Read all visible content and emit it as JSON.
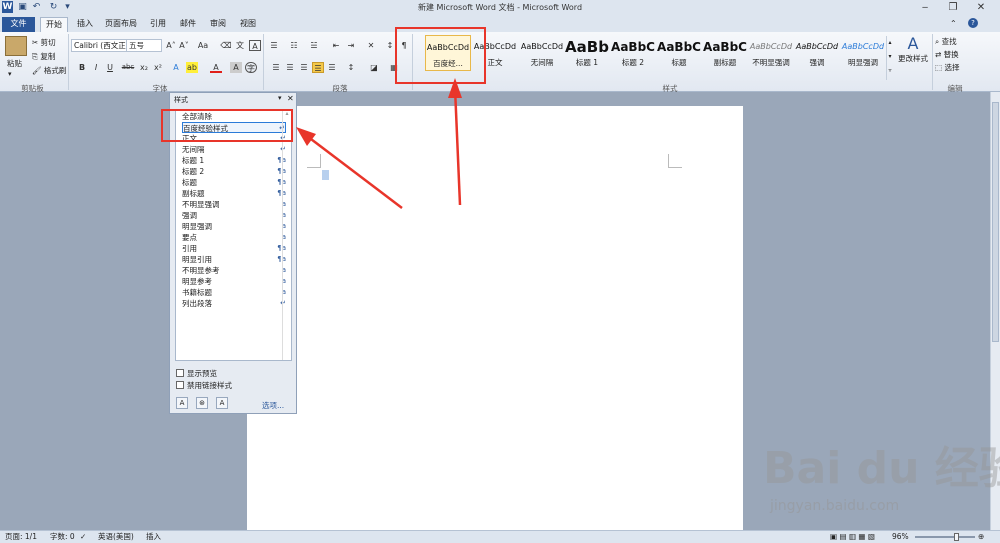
{
  "window": {
    "title": "新建 Microsoft Word 文档 - Microsoft Word",
    "minimize": "‒",
    "restore": "❐",
    "close": "✕"
  },
  "quick_access": {
    "app_icon": "W",
    "save": "▣",
    "undo": "↶",
    "redo": "↻",
    "customize": "▾"
  },
  "tabs": [
    "文件",
    "开始",
    "插入",
    "页面布局",
    "引用",
    "邮件",
    "审阅",
    "视图"
  ],
  "clipboard": {
    "paste": "粘贴",
    "cut": "剪切",
    "copy": "复制",
    "format_painter": "格式刷",
    "group": "剪贴板"
  },
  "font": {
    "name": "Calibri (西文正",
    "size": "五号",
    "grow": "A˄",
    "shrink": "A˅",
    "change_case": "Aa",
    "clear": "⌫",
    "phonetic": "文",
    "border": "A",
    "bold": "B",
    "italic": "I",
    "underline": "U",
    "strike": "abc",
    "sub": "x₂",
    "sup": "x²",
    "effects": "A",
    "highlight": "ab",
    "color": "A",
    "shade": "A",
    "enclose": "字",
    "group": "字体"
  },
  "paragraph": {
    "group": "段落",
    "bullets": "☰",
    "numbering": "☷",
    "multilevel": "☱",
    "dec_indent": "⇤",
    "inc_indent": "⇥",
    "chinese_layout": "✕",
    "sort": "↕",
    "show_marks": "¶",
    "align_left": "☰",
    "center": "☰",
    "align_right": "☰",
    "justify": "☰",
    "distribute": "☰",
    "line_spacing": "↕",
    "shading": "◪",
    "borders": "▦"
  },
  "styles": {
    "group": "样式",
    "items": [
      {
        "preview": "AaBbCcDd",
        "name": "百度经..."
      },
      {
        "preview": "AaBbCcDd",
        "name": "正文"
      },
      {
        "preview": "AaBbCcDd",
        "name": "无间隔"
      },
      {
        "preview": "AaBb",
        "name": "标题 1"
      },
      {
        "preview": "AaBbC",
        "name": "标题 2"
      },
      {
        "preview": "AaBbC",
        "name": "标题"
      },
      {
        "preview": "AaBbC",
        "name": "副标题"
      },
      {
        "preview": "AaBbCcDd",
        "name": "不明显强调"
      },
      {
        "preview": "AaBbCcDd",
        "name": "强调"
      },
      {
        "preview": "AaBbCcDd",
        "name": "明显强调"
      }
    ],
    "change": "更改样式"
  },
  "editing": {
    "find": "查找",
    "replace": "替换",
    "select": "选择",
    "group": "编辑"
  },
  "pane": {
    "title": "样式",
    "items": [
      {
        "name": "全部清除",
        "mark": ""
      },
      {
        "name": "百度经验样式",
        "mark": "↵"
      },
      {
        "name": "正文",
        "mark": "↵"
      },
      {
        "name": "无间隔",
        "mark": "↵"
      },
      {
        "name": "标题 1",
        "mark": "¶a"
      },
      {
        "name": "标题 2",
        "mark": "¶a"
      },
      {
        "name": "标题",
        "mark": "¶a"
      },
      {
        "name": "副标题",
        "mark": "¶a"
      },
      {
        "name": "不明显强调",
        "mark": "a"
      },
      {
        "name": "强调",
        "mark": "a"
      },
      {
        "name": "明显强调",
        "mark": "a"
      },
      {
        "name": "要点",
        "mark": "a"
      },
      {
        "name": "引用",
        "mark": "¶a"
      },
      {
        "name": "明显引用",
        "mark": "¶a"
      },
      {
        "name": "不明显参考",
        "mark": "a"
      },
      {
        "name": "明显参考",
        "mark": "a"
      },
      {
        "name": "书籍标题",
        "mark": "a"
      },
      {
        "name": "列出段落",
        "mark": "↵"
      }
    ],
    "show_preview": "显示预览",
    "disable_linked": "禁用链接样式",
    "options": "选项..."
  },
  "status": {
    "page": "页面: 1/1",
    "words": "字数: 0",
    "language": "英语(美国)",
    "insert": "插入",
    "zoom": "96%"
  },
  "watermark": {
    "logo": "Bai du 经验",
    "url": "jingyan.baidu.com"
  },
  "colors": {
    "accent": "#2b579a",
    "highlight_red": "#e8352a",
    "active_style": "#e8b84a"
  }
}
